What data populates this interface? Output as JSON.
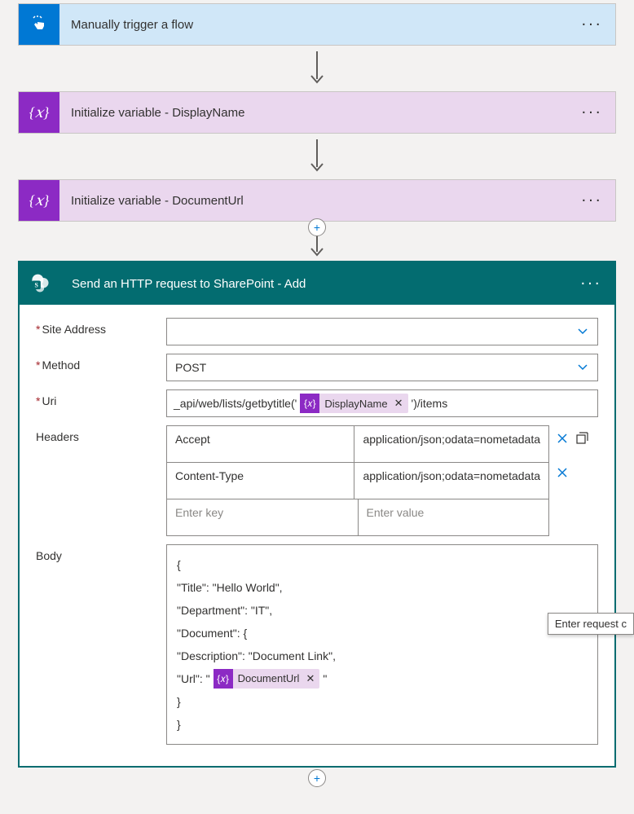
{
  "trigger": {
    "title": "Manually trigger a flow"
  },
  "var1": {
    "title": "Initialize variable - DisplayName"
  },
  "var2": {
    "title": "Initialize variable - DocumentUrl"
  },
  "http": {
    "title": "Send an HTTP request to SharePoint - Add",
    "labels": {
      "site_address": "Site Address",
      "method": "Method",
      "uri": "Uri",
      "headers": "Headers",
      "body": "Body"
    },
    "site_address": "",
    "method": "POST",
    "uri": {
      "prefix": "_api/web/lists/getbytitle('",
      "token": "DisplayName",
      "suffix": "')/items"
    },
    "headers": {
      "rows": [
        {
          "key": "Accept",
          "value": "application/json;odata=nometadata"
        },
        {
          "key": "Content-Type",
          "value": "application/json;odata=nometadata"
        }
      ],
      "placeholder_key": "Enter key",
      "placeholder_value": "Enter value"
    },
    "body": {
      "lines": {
        "l0": "{",
        "l1": "\"Title\": \"Hello World\",",
        "l2": "\"Department\": \"IT\",",
        "l3": "\"Document\": {",
        "l4": "\"Description\": \"Document Link\",",
        "l5_prefix": "\"Url\": \"",
        "l5_token": "DocumentUrl",
        "l5_suffix": "\"",
        "l6": "}",
        "l7": "}"
      }
    }
  },
  "tooltip": "Enter request c"
}
